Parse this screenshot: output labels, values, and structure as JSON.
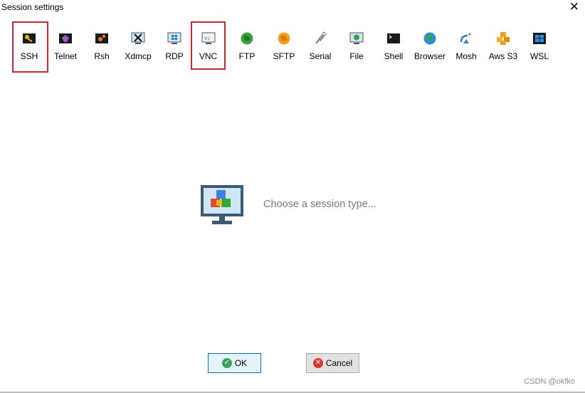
{
  "window": {
    "title": "Session settings",
    "close_glyph": "✕"
  },
  "toolbar": {
    "items": [
      {
        "label": "SSH",
        "icon": "key-icon",
        "highlighted": true
      },
      {
        "label": "Telnet",
        "icon": "telnet-icon",
        "highlighted": false
      },
      {
        "label": "Rsh",
        "icon": "rsh-icon",
        "highlighted": false
      },
      {
        "label": "Xdmcp",
        "icon": "xdmcp-icon",
        "highlighted": false
      },
      {
        "label": "RDP",
        "icon": "rdp-icon",
        "highlighted": false
      },
      {
        "label": "VNC",
        "icon": "vnc-icon",
        "highlighted": true
      },
      {
        "label": "FTP",
        "icon": "ftp-globe-icon",
        "highlighted": false
      },
      {
        "label": "SFTP",
        "icon": "sftp-globe-icon",
        "highlighted": false
      },
      {
        "label": "Serial",
        "icon": "serial-plug-icon",
        "highlighted": false
      },
      {
        "label": "File",
        "icon": "file-monitor-icon",
        "highlighted": false
      },
      {
        "label": "Shell",
        "icon": "shell-terminal-icon",
        "highlighted": false
      },
      {
        "label": "Browser",
        "icon": "browser-globe-icon",
        "highlighted": false
      },
      {
        "label": "Mosh",
        "icon": "mosh-satellite-icon",
        "highlighted": false
      },
      {
        "label": "Aws S3",
        "icon": "aws-s3-cubes-icon",
        "highlighted": false
      },
      {
        "label": "WSL",
        "icon": "wsl-windows-icon",
        "highlighted": false
      }
    ]
  },
  "center": {
    "message": "Choose a session type..."
  },
  "buttons": {
    "ok_label": "OK",
    "cancel_label": "Cancel"
  },
  "watermark": "CSDN @okfko",
  "colors": {
    "highlight": "#d9232e",
    "ok_accent": "#0078d7",
    "ok_icon": "#34a853",
    "cancel_icon": "#e0312f"
  }
}
